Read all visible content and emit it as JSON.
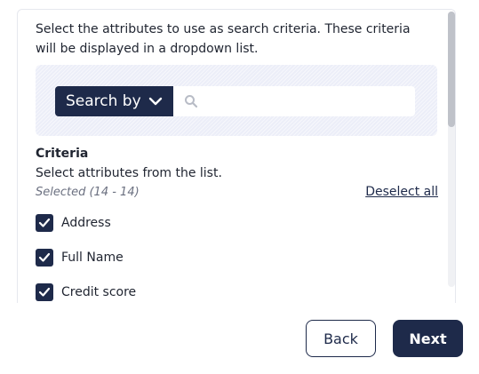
{
  "intro_text": "Select the attributes to use as search criteria. These criteria will be displayed in a dropdown list.",
  "search": {
    "dropdown_label": "Search by",
    "input_value": "",
    "input_placeholder": "",
    "icon": "search-icon"
  },
  "criteria": {
    "title": "Criteria",
    "subtitle": "Select attributes from the list.",
    "selected_count": "Selected (14 - 14)",
    "deselect_all": "Deselect all",
    "items": [
      {
        "label": "Address",
        "checked": true
      },
      {
        "label": "Full Name",
        "checked": true
      },
      {
        "label": "Credit score",
        "checked": true
      }
    ]
  },
  "buttons": {
    "back": "Back",
    "next": "Next"
  },
  "colors": {
    "primary": "#1e2a4a",
    "search_panel_bg": "#eceef8",
    "muted_text": "#6b7080"
  }
}
